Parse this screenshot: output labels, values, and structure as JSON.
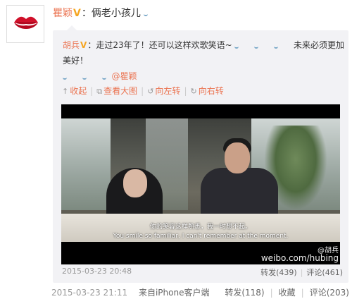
{
  "post": {
    "username": "瞿颖",
    "verified_badge": "V",
    "text": "：俩老小孩儿"
  },
  "repost": {
    "author": "胡兵",
    "verified_badge": "V",
    "text_part1": "：走过23年了！还可以这样欢歌笑语~",
    "text_part2": "未来必须更加美好！",
    "mention": "@瞿颖",
    "actions": {
      "collapse": "收起",
      "view_large": "查看大图",
      "rotate_left": "向左转",
      "rotate_right": "向右转"
    },
    "video": {
      "subtitle_zh": "你的笑容这样熟悉，我一时想不起。",
      "subtitle_en": "You smile so familiar, I can't remember at the moment.",
      "watermark_handle": "@胡兵",
      "watermark_url": "weibo.com/hubing"
    },
    "timestamp": "2015-03-23 20:48",
    "repost_label": "转发(439)",
    "comment_label": "评论(461)"
  },
  "footer": {
    "timestamp": "2015-03-23 21:11",
    "source": "来自iPhone客户端",
    "repost_label": "转发(118)",
    "favorite_label": "收藏",
    "comment_label": "评论(203)"
  },
  "colors": {
    "accent": "#eb7350",
    "badge": "#f5a623",
    "repost_bg": "#f2f2f5"
  },
  "icons": [
    "lips-avatar-icon",
    "collapse-icon",
    "view-large-icon",
    "rotate-left-icon",
    "rotate-right-icon",
    "emoji-icon"
  ]
}
